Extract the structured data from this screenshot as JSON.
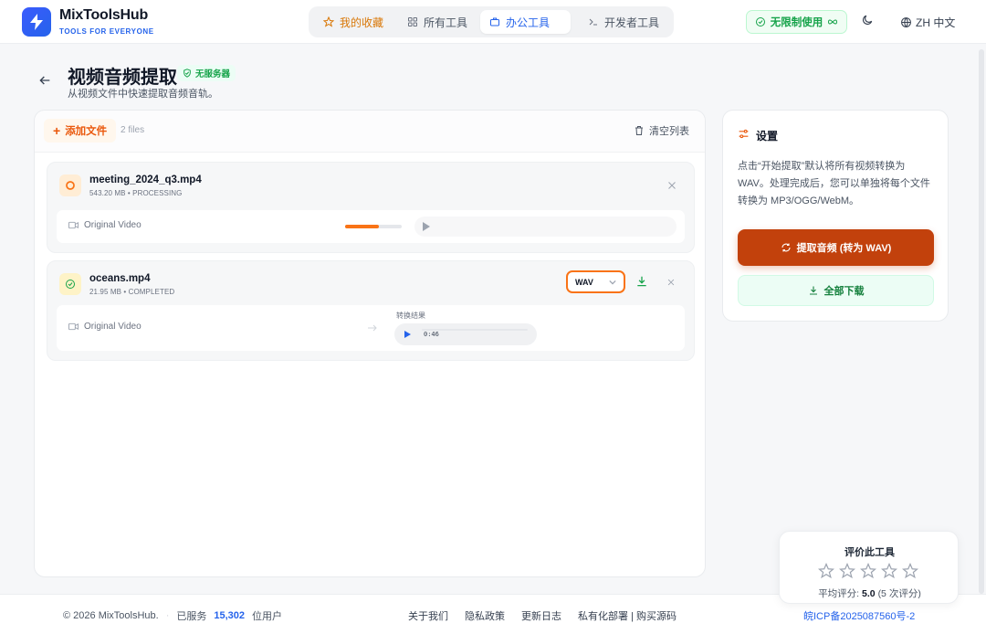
{
  "brand": {
    "name": "MixToolsHub",
    "tagline": "TOOLS FOR EVERYONE"
  },
  "nav": [
    {
      "label": "我的收藏",
      "icon": "star-icon"
    },
    {
      "label": "所有工具",
      "icon": "grid-icon"
    },
    {
      "label": "办公工具",
      "icon": "briefcase-icon",
      "active": true
    },
    {
      "label": "开发者工具",
      "icon": "terminal-icon"
    }
  ],
  "header": {
    "unlimited": "无限制使用",
    "lang": "ZH 中文"
  },
  "page": {
    "title": "视频音频提取",
    "badge": "无服务器",
    "subtitle": "从视频文件中快速提取音频音轨。"
  },
  "toolbar": {
    "add_file": "添加文件",
    "file_count": "2 files",
    "clear": "清空列表"
  },
  "files": [
    {
      "name": "meeting_2024_q3.mp4",
      "meta": "543.20 MB • PROCESSING",
      "original_label": "Original Video",
      "progress": 0.6
    },
    {
      "name": "oceans.mp4",
      "meta": "21.95 MB • COMPLETED",
      "original_label": "Original Video",
      "format": "WAV",
      "result_label": "转换结果",
      "duration": "0:46"
    }
  ],
  "settings": {
    "title": "设置",
    "description": "点击“开始提取”默认将所有视频转换为 WAV。处理完成后，您可以单独将每个文件转换为 MP3/OGG/WebM。",
    "extract_button": "提取音频 (转为 WAV)",
    "download_all": "全部下载"
  },
  "rating": {
    "title": "评价此工具",
    "avg_label": "平均评分:",
    "avg_value": "5.0",
    "count": "(5 次评分)"
  },
  "footer": {
    "copyright": "© 2026 MixToolsHub.",
    "served_prefix": "已服务",
    "served_count": "15,302",
    "served_suffix": "位用户",
    "links": [
      "关于我们",
      "隐私政策",
      "更新日志",
      "私有化部署 | 购买源码"
    ],
    "icp": "皖ICP备2025087560号-2"
  },
  "colors": {
    "accent": "#2563eb",
    "orange": "#f97316",
    "brand_dark_orange": "#c2410c",
    "success": "#16a34a"
  }
}
